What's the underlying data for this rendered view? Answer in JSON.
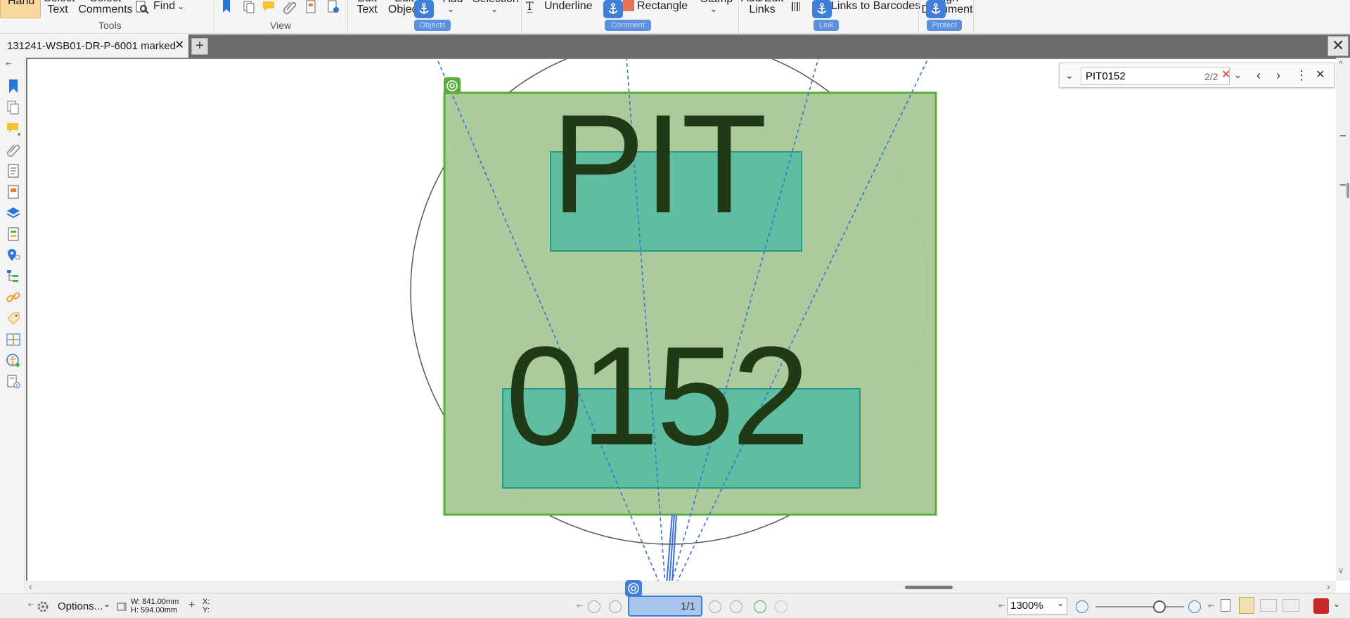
{
  "ribbon": {
    "tools_group": {
      "hand_label": "Hand",
      "select_text_label": "Select Text",
      "select_comments_label": "Select Comments",
      "find_label": "Find",
      "group_label": "Tools"
    },
    "view_group": {
      "group_label": "View"
    },
    "edit_group": {
      "edit_text_label": "Edit Text",
      "edit_object_label": "Edit Object",
      "add_label": "Add",
      "selection_label": "Selection",
      "anchor_tag": "Objects"
    },
    "comment_group": {
      "underline_label": "Underline",
      "rectangle_label": "Rectangle",
      "stamp_label": "Stamp",
      "anchor_tag": "Comment"
    },
    "links_group": {
      "add_edit_links_label": "Add/Edit Links",
      "links_to_barcodes_label": "Links to Barcodes",
      "anchor_tag": "Link"
    },
    "protect_group": {
      "sign_document_label": "Sign Document",
      "anchor_tag": "Protect"
    }
  },
  "tabs": {
    "document_tab_label": "131241-WSB01-DR-P-6001 marked"
  },
  "document": {
    "annotation_text_line1": "PIT",
    "annotation_text_line2": "0152",
    "colors": {
      "annotation_fill": "#a9c99a",
      "annotation_border": "#5cab3c",
      "highlight_fill": "#5fbda2",
      "highlight_border": "#2a9a86",
      "text_color": "#1f3a14",
      "leader_line": "#3d6fd4"
    }
  },
  "find_bar": {
    "search_value": "PIT0152",
    "match_count": "2/2"
  },
  "status_bar": {
    "options_label": "Options...",
    "width_readout": "W: 841.00mm",
    "height_readout": "H: 594.00mm",
    "x_readout": "X:",
    "y_readout": "Y:",
    "page_value": "1/1",
    "zoom_value": "1300%"
  }
}
